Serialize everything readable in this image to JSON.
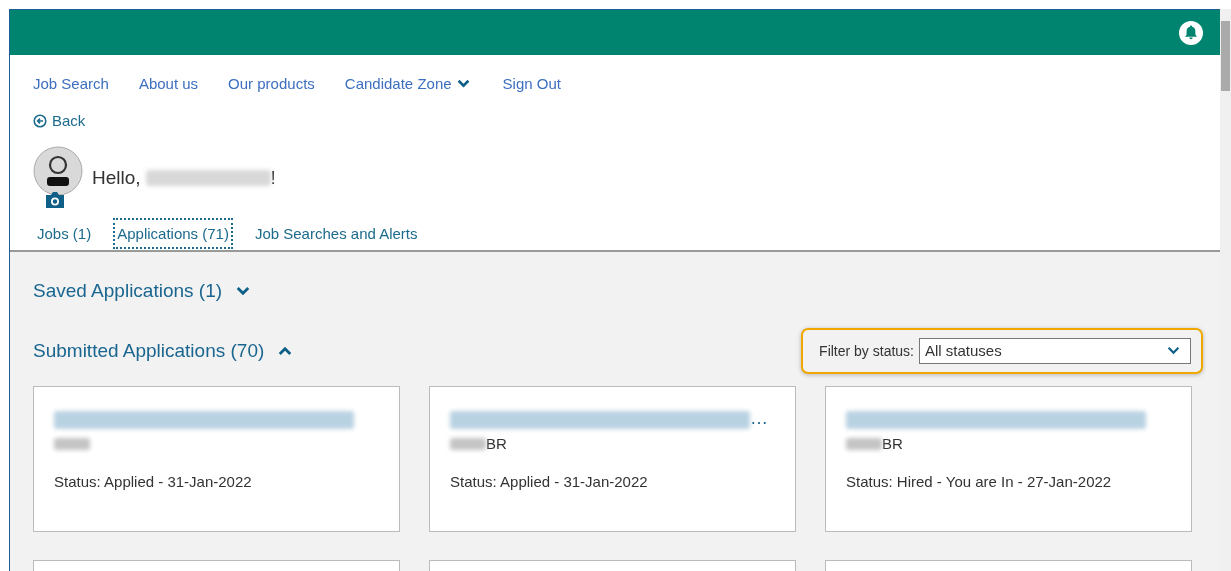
{
  "nav": {
    "items": [
      {
        "label": "Job Search",
        "kind": "link"
      },
      {
        "label": "About us",
        "kind": "link"
      },
      {
        "label": "Our products",
        "kind": "link"
      },
      {
        "label": "Candidate Zone",
        "kind": "dropdown"
      },
      {
        "label": "Sign Out",
        "kind": "link"
      }
    ]
  },
  "back": {
    "label": "Back"
  },
  "greeting": {
    "prefix": "Hello,",
    "suffix": "!"
  },
  "tabs": [
    {
      "label": "Jobs (1)",
      "selected": false
    },
    {
      "label": "Applications (71)",
      "selected": true
    },
    {
      "label": "Job Searches and Alerts",
      "selected": false
    }
  ],
  "sections": [
    {
      "title": "Saved Applications (1)",
      "expanded": false
    },
    {
      "title": "Submitted Applications (70)",
      "expanded": true
    }
  ],
  "filter": {
    "label": "Filter by status:",
    "value": "All statuses"
  },
  "cards": [
    {
      "status": "Status: Applied - 31-Jan-2022"
    },
    {
      "title_suffix": "…",
      "location": "BR",
      "status": "Status: Applied - 31-Jan-2022"
    },
    {
      "location": "BR",
      "status": "Status: Hired - You are In - 27-Jan-2022"
    }
  ]
}
